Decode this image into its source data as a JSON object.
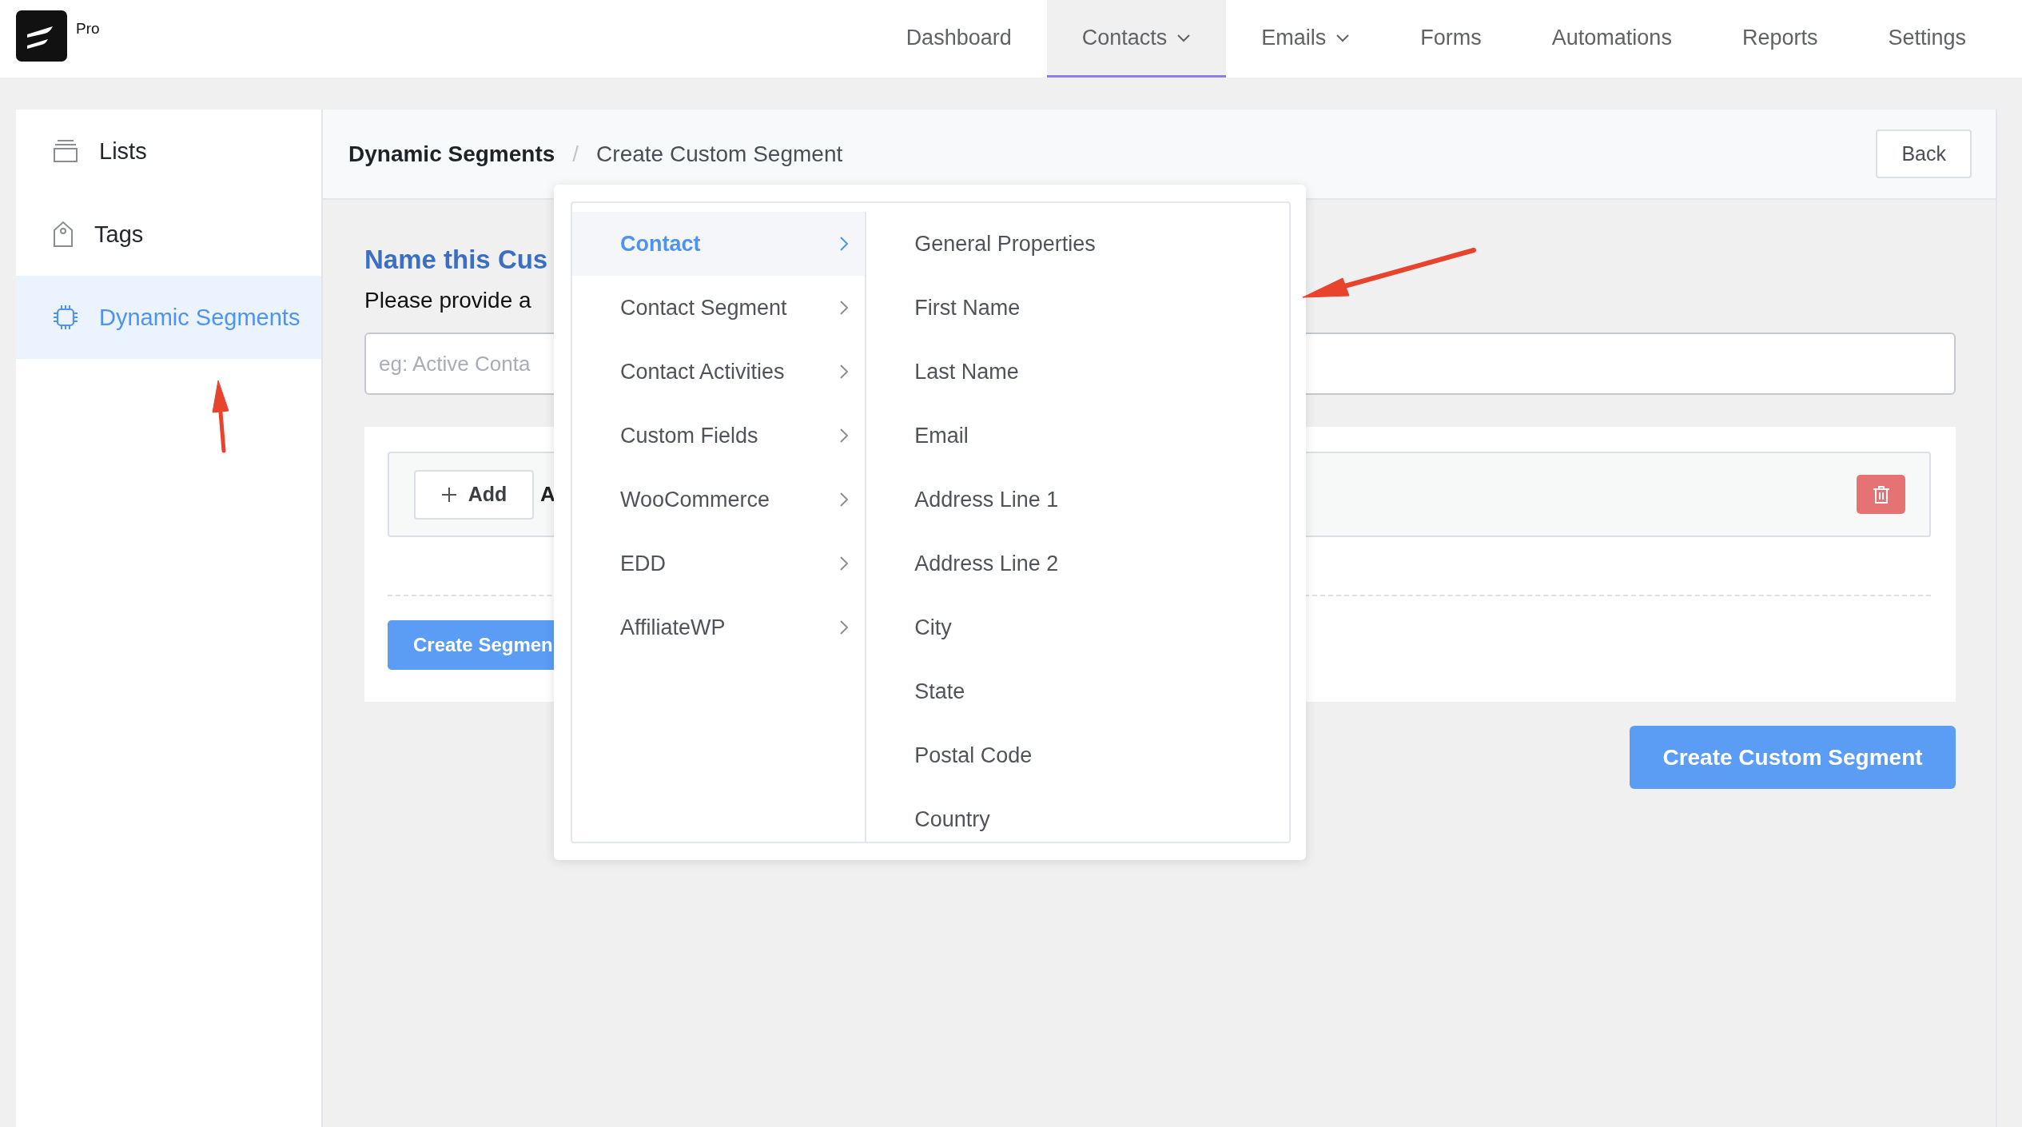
{
  "app": {
    "badge": "Pro"
  },
  "nav": [
    {
      "label": "Dashboard",
      "selected": false,
      "dropdown": false
    },
    {
      "label": "Contacts",
      "selected": true,
      "dropdown": true
    },
    {
      "label": "Emails",
      "selected": false,
      "dropdown": true
    },
    {
      "label": "Forms",
      "selected": false,
      "dropdown": false
    },
    {
      "label": "Automations",
      "selected": false,
      "dropdown": false
    },
    {
      "label": "Reports",
      "selected": false,
      "dropdown": false
    },
    {
      "label": "Settings",
      "selected": false,
      "dropdown": false
    }
  ],
  "sidebar": {
    "items": [
      {
        "label": "Lists",
        "kind": "stack",
        "selected": false
      },
      {
        "label": "Tags",
        "kind": "tag",
        "selected": false
      },
      {
        "label": "Dynamic Segments",
        "kind": "chip",
        "selected": true
      }
    ]
  },
  "header": {
    "breadcrumb": [
      "Dynamic Segments",
      "Create Custom Segment"
    ],
    "separator": "/",
    "back": "Back"
  },
  "form": {
    "heading": "Name this Cus",
    "prompt": "Please provide a",
    "name_field": {
      "placeholder": "eg: Active Conta"
    },
    "add_button": "Add",
    "add_trailing": "A",
    "submit_segment": "Create Segmen"
  },
  "create_button": "Create Custom Segment",
  "menu": {
    "categories": [
      {
        "label": "Contact",
        "selected": true
      },
      {
        "label": "Contact Segment",
        "selected": false
      },
      {
        "label": "Contact Activities",
        "selected": false
      },
      {
        "label": "Custom Fields",
        "selected": false
      },
      {
        "label": "WooCommerce",
        "selected": false
      },
      {
        "label": "EDD",
        "selected": false
      },
      {
        "label": "AffiliateWP",
        "selected": false
      }
    ],
    "options": [
      "General Properties",
      "First Name",
      "Last Name",
      "Email",
      "Address Line 1",
      "Address Line 2",
      "City",
      "State",
      "Postal Code",
      "Country"
    ]
  }
}
